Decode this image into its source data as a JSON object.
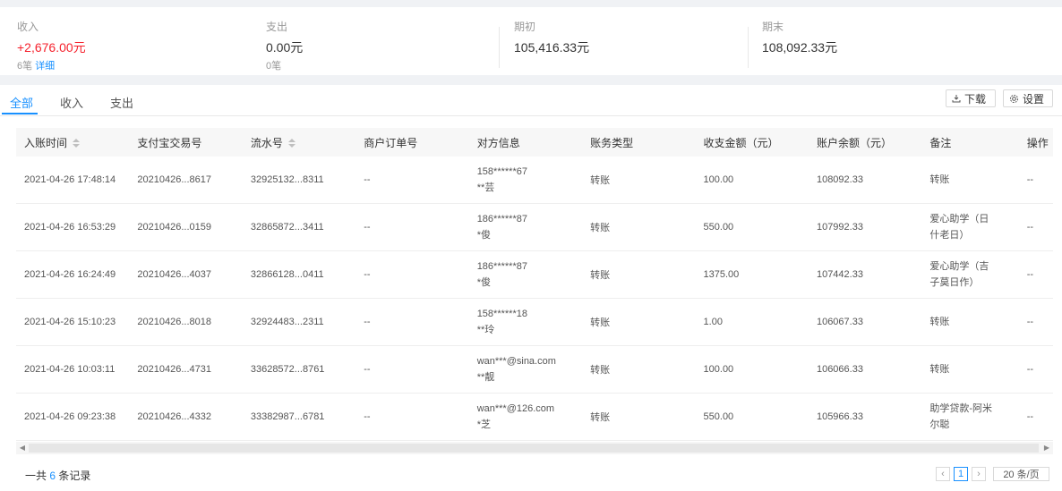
{
  "summary": {
    "income": {
      "label": "收入",
      "value": "+2,676.00元",
      "sub_count": "6笔",
      "sub_link": "详细"
    },
    "expense": {
      "label": "支出",
      "value": "0.00元",
      "sub_count": "0笔"
    },
    "opening": {
      "label": "期初",
      "value": "105,416.33元"
    },
    "closing": {
      "label": "期末",
      "value": "108,092.33元"
    }
  },
  "tabs": [
    "全部",
    "收入",
    "支出"
  ],
  "toolbar": {
    "download_label": "下载",
    "settings_label": "设置"
  },
  "table": {
    "columns": [
      "入账时间",
      "支付宝交易号",
      "流水号",
      "商户订单号",
      "对方信息",
      "账务类型",
      "收支金额（元）",
      "账户余额（元）",
      "备注",
      "操作"
    ],
    "rows": [
      {
        "time": "2021-04-26 17:48:14",
        "trade_no": "20210426...8617",
        "serial": "32925132...8311",
        "order": "--",
        "party_acct": "158******67",
        "party_name": "**芸",
        "type": "转账",
        "amount": "100.00",
        "balance": "108092.33",
        "remark_1": "转账",
        "remark_2": "",
        "op": "--"
      },
      {
        "time": "2021-04-26 16:53:29",
        "trade_no": "20210426...0159",
        "serial": "32865872...3411",
        "order": "--",
        "party_acct": "186******87",
        "party_name": "*俊",
        "type": "转账",
        "amount": "550.00",
        "balance": "107992.33",
        "remark_1": "爱心助学（日",
        "remark_2": "什老日）",
        "op": "--"
      },
      {
        "time": "2021-04-26 16:24:49",
        "trade_no": "20210426...4037",
        "serial": "32866128...0411",
        "order": "--",
        "party_acct": "186******87",
        "party_name": "*俊",
        "type": "转账",
        "amount": "1375.00",
        "balance": "107442.33",
        "remark_1": "爱心助学（吉",
        "remark_2": "子莫日作）",
        "op": "--"
      },
      {
        "time": "2021-04-26 15:10:23",
        "trade_no": "20210426...8018",
        "serial": "32924483...2311",
        "order": "--",
        "party_acct": "158******18",
        "party_name": "**玲",
        "type": "转账",
        "amount": "1.00",
        "balance": "106067.33",
        "remark_1": "转账",
        "remark_2": "",
        "op": "--"
      },
      {
        "time": "2021-04-26 10:03:11",
        "trade_no": "20210426...4731",
        "serial": "33628572...8761",
        "order": "--",
        "party_acct": "wan***@sina.com",
        "party_name": "**靓",
        "type": "转账",
        "amount": "100.00",
        "balance": "106066.33",
        "remark_1": "转账",
        "remark_2": "",
        "op": "--"
      },
      {
        "time": "2021-04-26 09:23:38",
        "trade_no": "20210426...4332",
        "serial": "33382987...6781",
        "order": "--",
        "party_acct": "wan***@126.com",
        "party_name": "*芝",
        "type": "转账",
        "amount": "550.00",
        "balance": "105966.33",
        "remark_1": "助学贷款-阿米",
        "remark_2": "尔聪",
        "op": "--"
      }
    ]
  },
  "footer": {
    "total_prefix": "一共",
    "total_count": "6",
    "total_suffix": "条记录"
  },
  "pagination": {
    "current_page": "1",
    "page_size": "20 条/页",
    "prev_icon": "‹",
    "next_icon": "›"
  },
  "colors": {
    "accent": "#1890ff",
    "income": "#f5222d"
  }
}
